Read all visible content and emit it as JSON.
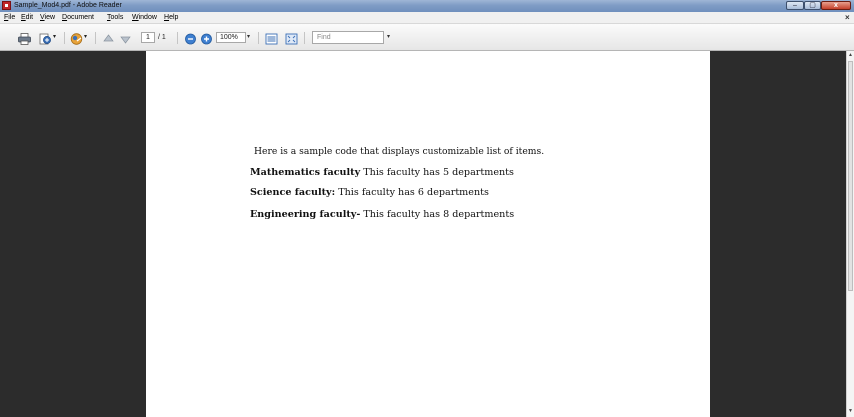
{
  "window": {
    "title": "Sample_Mod4.pdf - Adobe Reader",
    "controls": {
      "minimize": "–",
      "maximize": "▢",
      "close": "x"
    }
  },
  "menu": {
    "items": [
      {
        "mnemonic": "F",
        "rest": "ile"
      },
      {
        "mnemonic": "E",
        "rest": "dit"
      },
      {
        "mnemonic": "V",
        "rest": "iew"
      },
      {
        "mnemonic": "D",
        "rest": "ocument"
      },
      {
        "mnemonic": "T",
        "rest": "ools"
      },
      {
        "mnemonic": "W",
        "rest": "indow"
      },
      {
        "mnemonic": "H",
        "rest": "elp"
      }
    ],
    "close_doc": "×"
  },
  "toolbar": {
    "icons": [
      "print-icon",
      "create-pdf-icon",
      "collaborate-icon",
      "previous-page-icon",
      "next-page-icon",
      "zoom-out-icon",
      "zoom-in-icon",
      "fit-width-icon",
      "fit-page-icon"
    ],
    "page_current": "1",
    "page_total": "/ 1",
    "zoom": "100%",
    "find_placeholder": "Find"
  },
  "document": {
    "intro": "Here is a sample code that displays customizable list of items.",
    "rows": [
      {
        "term": "Mathematics faculty",
        "desc": "This faculty has 5 departments"
      },
      {
        "term": "Science faculty:",
        "desc": "This faculty has 6 departments"
      },
      {
        "term": "Engineering faculty-",
        "desc": "This faculty has 8 departments"
      }
    ]
  },
  "colors": {
    "titlebar": "#7f9cc5",
    "workspace": "#2c2c2c",
    "page": "#ffffff"
  }
}
